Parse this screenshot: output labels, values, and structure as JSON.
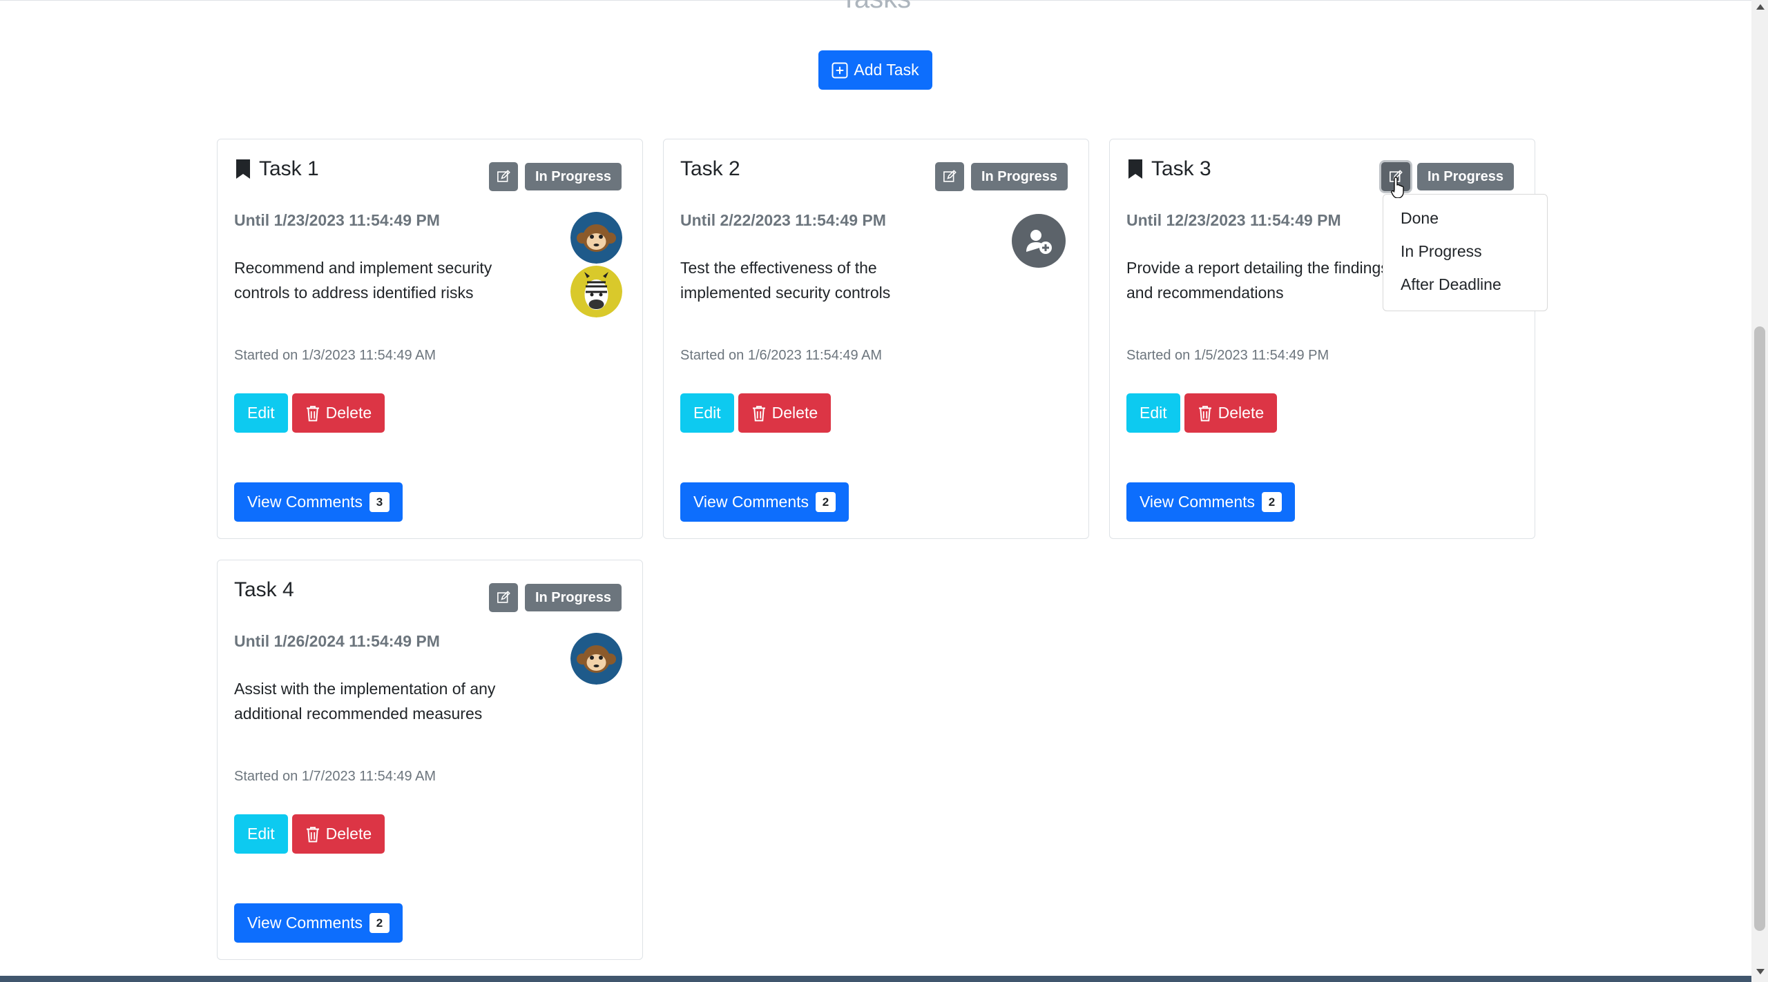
{
  "page": {
    "heading": "Tasks"
  },
  "add_task": {
    "label": "Add Task",
    "icon": "plus-square-icon"
  },
  "tasks": [
    {
      "title": "Task 1",
      "bookmarked": true,
      "status": "In Progress",
      "due": "Until 1/23/2023 11:54:49 PM",
      "description": "Recommend and implement security controls to address identified risks",
      "started": "Started on 1/3/2023 11:54:49 AM",
      "assignees": [
        "monkey-avatar",
        "zebra-avatar"
      ],
      "edit_label": "Edit",
      "delete_label": "Delete",
      "comments_label": "View Comments",
      "comments_count": "3"
    },
    {
      "title": "Task 2",
      "bookmarked": false,
      "status": "In Progress",
      "due": "Until 2/22/2023 11:54:49 PM",
      "description": "Test the effectiveness of the implemented security controls",
      "started": "Started on 1/6/2023 11:54:49 AM",
      "assignees": [],
      "edit_label": "Edit",
      "delete_label": "Delete",
      "comments_label": "View Comments",
      "comments_count": "2"
    },
    {
      "title": "Task 3",
      "bookmarked": true,
      "status": "In Progress",
      "due": "Until 12/23/2023 11:54:49 PM",
      "description": "Provide a report detailing the findings and recommendations",
      "started": "Started on 1/5/2023 11:54:49 PM",
      "assignees": [],
      "edit_label": "Edit",
      "delete_label": "Delete",
      "comments_label": "View Comments",
      "comments_count": "2"
    },
    {
      "title": "Task 4",
      "bookmarked": false,
      "status": "In Progress",
      "due": "Until 1/26/2024 11:54:49 PM",
      "description": "Assist with the implementation of any additional recommended measures",
      "started": "Started on 1/7/2023 11:54:49 AM",
      "assignees": [
        "monkey-avatar"
      ],
      "edit_label": "Edit",
      "delete_label": "Delete",
      "comments_label": "View Comments",
      "comments_count": "2"
    }
  ],
  "status_dropdown": {
    "items": [
      "Done",
      "In Progress",
      "After Deadline"
    ]
  },
  "colors": {
    "primary": "#0d6efd",
    "info": "#0dcaf0",
    "danger": "#dc3545",
    "secondary": "#6c757d"
  }
}
